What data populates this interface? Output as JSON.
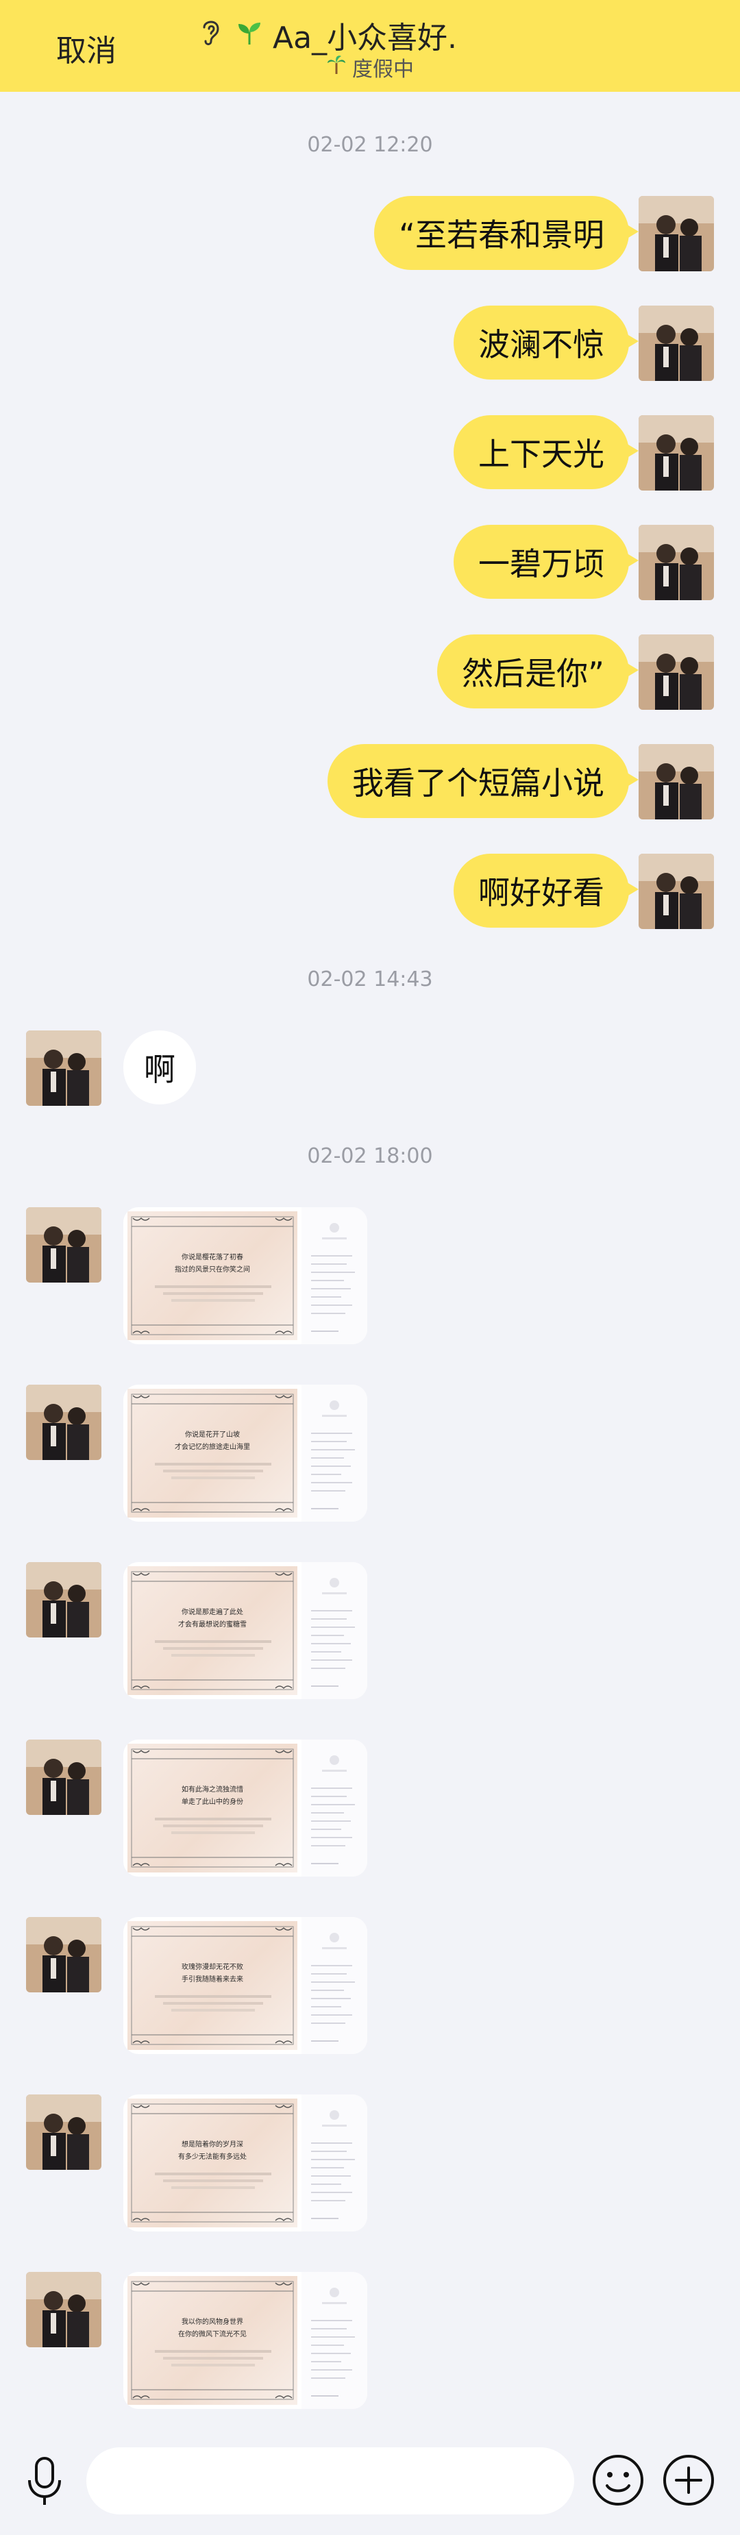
{
  "header": {
    "cancel_label": "取消",
    "title_name": "Aa_小众喜好.",
    "subtitle": "度假中",
    "icons": [
      "ear-icon",
      "sprout-icon",
      "palm-icon"
    ]
  },
  "timestamps": [
    "02-02 12:20",
    "02-02 14:43",
    "02-02 18:00"
  ],
  "messages_outgoing": [
    "“至若春和景明",
    "波澜不惊",
    "上下天光",
    "一碧万顷",
    "然后是你”",
    "我看了个短篇小说",
    "啊好好看"
  ],
  "messages_incoming": [
    "啊"
  ],
  "image_messages": {
    "count": 7,
    "captions": [
      [
        "你说是樱花落了初春",
        "指过的风景只在你笑之间"
      ],
      [
        "你说是花开了山坡",
        "才会记忆的旅途走山海里"
      ],
      [
        "你说是那走遍了此处",
        "才会有最想说的蜜糖雪"
      ],
      [
        "如有此海之流独流惜",
        "单走了此山中的身份"
      ],
      [
        "玫瑰弥漫却无花不败",
        "手引我随随着来去来"
      ],
      [
        "想是陪着你的岁月深",
        "有多少无法能有多远处"
      ],
      [
        "我以你的风物身世界",
        "在你的微风下流光不见"
      ]
    ]
  },
  "input": {
    "placeholder": ""
  },
  "colors": {
    "accent": "#fde55a",
    "background": "#f2f3f8"
  }
}
